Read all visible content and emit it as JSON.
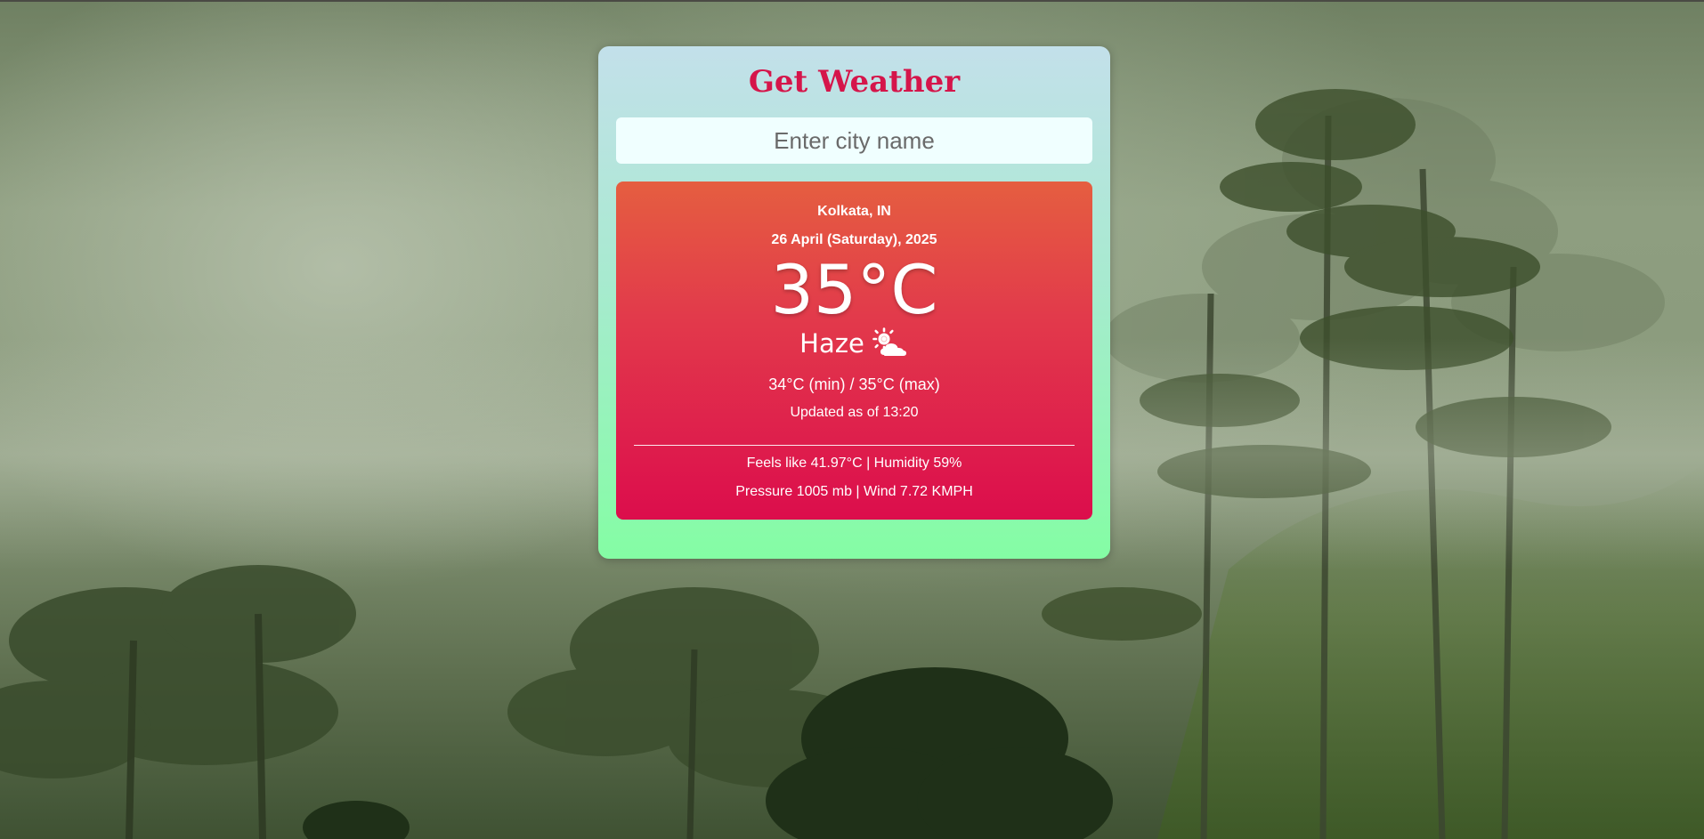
{
  "app": {
    "title": "Get Weather"
  },
  "search": {
    "placeholder": "Enter city name",
    "value": ""
  },
  "weather": {
    "location": "Kolkata, IN",
    "date": "26 April (Saturday), 2025",
    "temperature": "35°C",
    "condition": "Haze",
    "condition_icon": "sun-behind-cloud-icon",
    "minmax": "34°C (min) / 35°C (max)",
    "updated": "Updated as of 13:20",
    "details_line1": "Feels like 41.97°C | Humidity 59%",
    "details_line2": "Pressure 1005 mb | Wind 7.72 KMPH"
  },
  "colors": {
    "title": "#d5154a",
    "card_top": "#c3e0ea",
    "card_bottom": "#84fda4",
    "panel_top": "#e55e40",
    "panel_bottom": "#dc0d4c",
    "input_bg": "#f0ffff"
  },
  "background": {
    "description_icon": "misty-forest-background"
  }
}
